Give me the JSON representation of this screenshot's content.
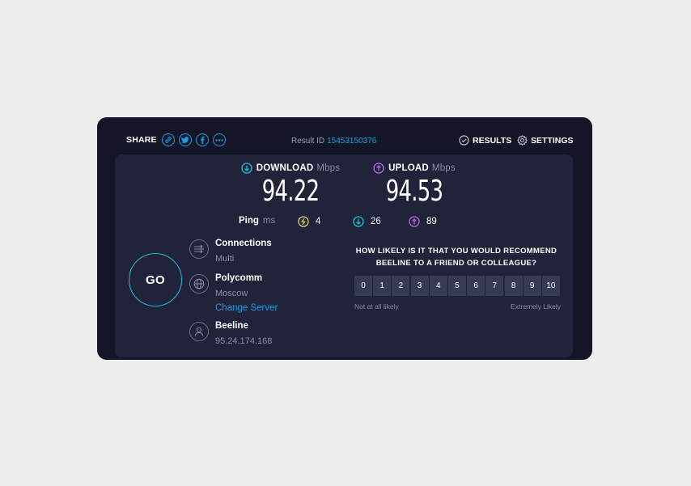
{
  "header": {
    "share_label": "SHARE",
    "share_icons": [
      "link-icon",
      "twitter-icon",
      "facebook-icon",
      "more-icon"
    ],
    "result_label": "Result ID",
    "result_id": "15453150376",
    "results_label": "RESULTS",
    "settings_label": "SETTINGS"
  },
  "download": {
    "label": "DOWNLOAD",
    "unit": "Mbps",
    "value": "94.22"
  },
  "upload": {
    "label": "UPLOAD",
    "unit": "Mbps",
    "value": "94.53"
  },
  "ping": {
    "label": "Ping",
    "unit": "ms",
    "idle": "4",
    "download": "26",
    "upload": "89"
  },
  "go_label": "GO",
  "connections": {
    "title": "Connections",
    "value": "Multi"
  },
  "server": {
    "title": "Polycomm",
    "location": "Moscow",
    "change_label": "Change Server"
  },
  "provider": {
    "title": "Beeline",
    "ip": "95.24.174.168"
  },
  "survey": {
    "question": "HOW LIKELY IS IT THAT YOU WOULD RECOMMEND BEELINE TO A FRIEND OR COLLEAGUE?",
    "options": [
      "0",
      "1",
      "2",
      "3",
      "4",
      "5",
      "6",
      "7",
      "8",
      "9",
      "10"
    ],
    "low_label": "Not at all likely",
    "high_label": "Extremely Likely"
  },
  "colors": {
    "accent": "#1aa0e4",
    "download": "#17c1d8",
    "upload": "#b868e6",
    "idle": "#e8d46a",
    "card": "#141628",
    "panel": "#202339"
  }
}
